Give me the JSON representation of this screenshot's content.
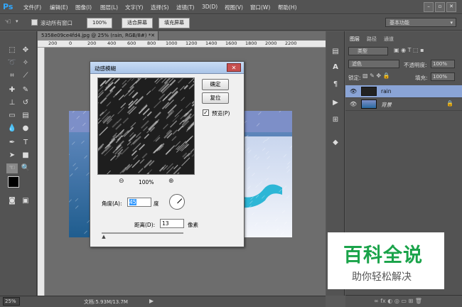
{
  "app": {
    "logo": "Ps",
    "accent": "#31a8ff"
  },
  "menu": [
    "文件(F)",
    "编辑(E)",
    "图像(I)",
    "图层(L)",
    "文字(Y)",
    "选择(S)",
    "滤镜(T)",
    "3D(D)",
    "视图(V)",
    "窗口(W)",
    "帮助(H)"
  ],
  "options": {
    "scroll_all_label": "滚动所有窗口",
    "zoom_value": "100%",
    "fit_screen": "适合屏幕",
    "fill_screen": "填充屏幕",
    "workspace": "基本功能"
  },
  "document": {
    "tab_title": "5358e09ce4fd4.jpg @ 25% (rain, RGB/8#) *",
    "ruler_ticks": [
      "200",
      "0",
      "200",
      "400",
      "600",
      "800",
      "1000",
      "1200",
      "1400",
      "1600",
      "1800",
      "2000",
      "2200"
    ]
  },
  "dialog": {
    "title": "动感模糊",
    "ok": "确定",
    "reset": "复位",
    "preview_label": "预览(P)",
    "preview_checked": true,
    "zoom_percent": "100%",
    "angle_label": "角度(A):",
    "angle_value": "45",
    "angle_unit": "度",
    "distance_label": "距离(D):",
    "distance_value": "13",
    "distance_unit": "像素",
    "distance_fraction": 0.02
  },
  "status": {
    "zoom": "25%",
    "doc_size": "文档:5.93M/13.7M"
  },
  "layers": {
    "tabs": [
      "图层",
      "路径",
      "通道"
    ],
    "filter_kind": "类型",
    "blend_mode": "滤色",
    "opacity_label": "不透明度:",
    "opacity_value": "100%",
    "lock_label": "锁定:",
    "fill_label": "填充:",
    "fill_value": "100%",
    "items": [
      {
        "name": "rain",
        "selected": true
      },
      {
        "name": "背景",
        "selected": false,
        "locked": true
      }
    ]
  },
  "watermark": {
    "title": "百科全说",
    "subtitle": "助你轻松解决",
    "color": "#1aa34a"
  }
}
